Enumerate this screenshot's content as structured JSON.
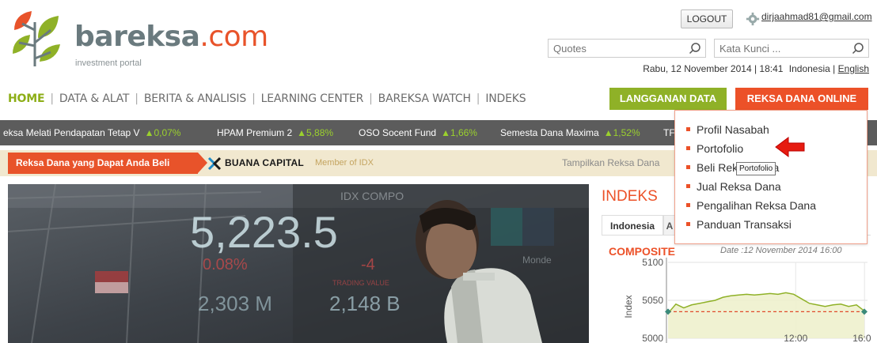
{
  "brand": {
    "name": "bareksa",
    "suffix": ".com",
    "tagline": "investment portal",
    "colors": {
      "green": "#8fb127",
      "orange": "#ec5128",
      "gray": "#6a7a7e"
    }
  },
  "header": {
    "logout_label": "LOGOUT",
    "user_email": "dirjaahmad81@gmail.com",
    "quotes_placeholder": "Quotes",
    "keyword_placeholder": "Kata Kunci ...",
    "date_text": "Rabu, 12 November 2014 | 18:41",
    "lang_id": "Indonesia",
    "lang_sep": "|",
    "lang_en": "English"
  },
  "nav": {
    "items": [
      {
        "label": "HOME"
      },
      {
        "label": "DATA & ALAT"
      },
      {
        "label": "BERITA & ANALISIS"
      },
      {
        "label": "LEARNING CENTER"
      },
      {
        "label": "BAREKSA WATCH"
      },
      {
        "label": "INDEKS"
      }
    ],
    "separator": "|",
    "langganan_label": "LANGGANAN DATA",
    "reksa_online_label": "REKSA DANA ONLINE"
  },
  "ticker": [
    {
      "name": "eksa Melati Pendapatan Tetap V",
      "change": "▲0,07%"
    },
    {
      "name": "HPAM Premium 2",
      "change": "▲5,88%"
    },
    {
      "name": "OSO Socent Fund",
      "change": "▲1,66%"
    },
    {
      "name": "Semesta Dana Maxima",
      "change": "▲1,52%"
    },
    {
      "name": "TF",
      "change": ""
    }
  ],
  "sponsor": {
    "tag": "Reksa Dana yang Dapat Anda Beli",
    "partner": "BUANA CAPITAL",
    "member": "Member of IDX",
    "show_funds": "Tampilkan Reksa Dana"
  },
  "hero": {
    "board_number": "5,223.5",
    "board_pct": "0.08%",
    "board_vol": "2,303 M",
    "board_val": "2,148 B",
    "board_caption": "IDX COMPO",
    "board_neg": "-4",
    "board_value_label": "TRADING VALUE",
    "board_side": "Monde"
  },
  "indeks": {
    "title": "INDEKS",
    "tab_active": "Indonesia",
    "tab_other": "A",
    "composite_label": "COMPOSITE",
    "date": "Date :12 November 2014 16:00"
  },
  "chart_data": {
    "type": "line",
    "ylabel": "Index",
    "y_ticks": [
      "5100",
      "5050",
      "5000"
    ],
    "ylim": [
      5000,
      5100
    ],
    "x_ticks": [
      "12:00",
      "16:00"
    ],
    "reference_value": 5035,
    "series": [
      {
        "values": [
          5033,
          5045,
          5040,
          5044,
          5046,
          5048,
          5050,
          5054,
          5056,
          5057,
          5058,
          5057,
          5058,
          5059,
          5058,
          5060,
          5058,
          5052,
          5046,
          5044,
          5042,
          5044,
          5045,
          5042,
          5044,
          5036
        ]
      }
    ],
    "grid": true,
    "colors": {
      "line": "#8fb127",
      "fill": "#eef1cd",
      "ref": "#e04a2a",
      "marker": "#3a8a7a"
    }
  },
  "dropdown": {
    "items": [
      {
        "label": "Profil Nasabah"
      },
      {
        "label": "Portofolio"
      },
      {
        "label": "Beli Reksa Dana"
      },
      {
        "label": "Jual Reksa Dana"
      },
      {
        "label": "Pengalihan Reksa Dana"
      },
      {
        "label": "Panduan Transaksi"
      }
    ],
    "tooltip": "Portofolio"
  }
}
